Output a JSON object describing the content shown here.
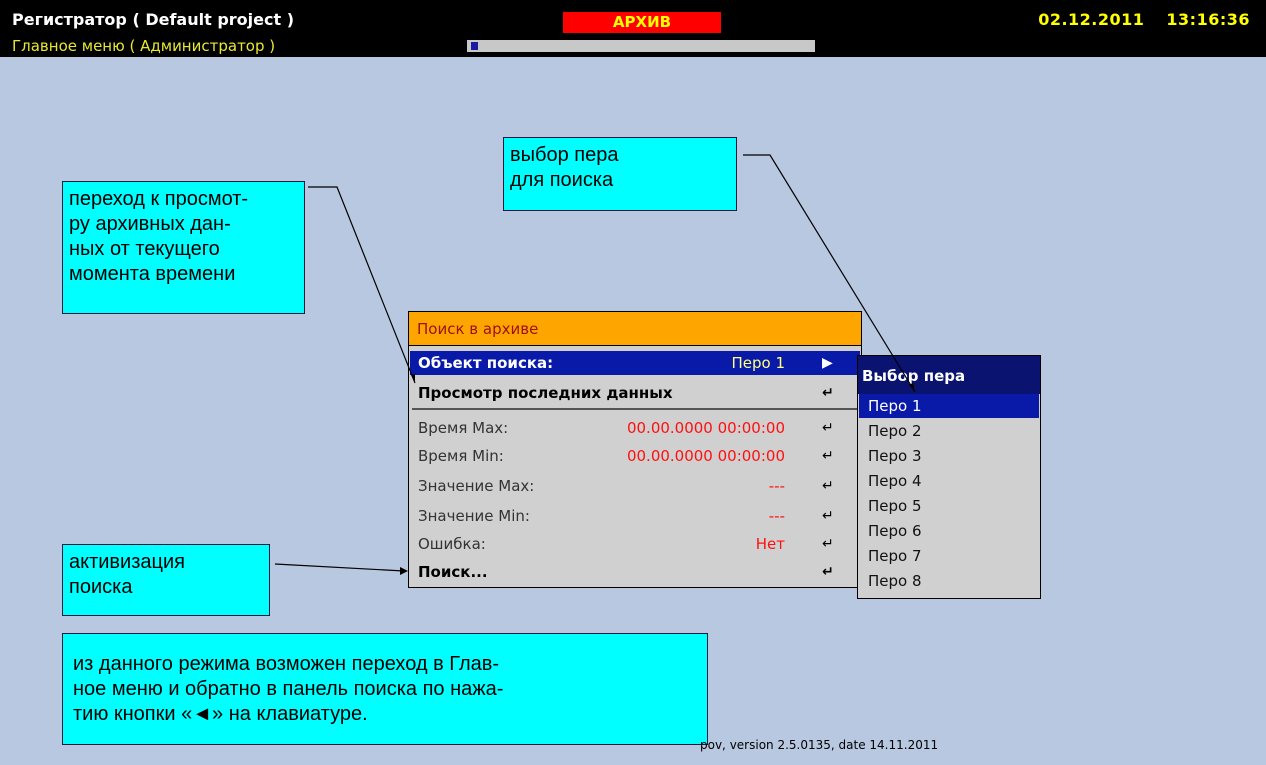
{
  "header": {
    "title": "Регистратор ( Default project )",
    "subtitle": "Главное меню ( Администратор )",
    "mode": "АРХИВ",
    "progress_fraction": 0.02,
    "date": "02.12.2011",
    "time": "13:16:36"
  },
  "dialog": {
    "title": "Поиск в архиве",
    "rows": [
      {
        "label": "Объект поиска:",
        "value": "Перо 1",
        "icon": "arrow-right-icon"
      },
      {
        "label": "Просмотр последних данных",
        "value": "",
        "icon": "enter-icon"
      },
      {
        "label": "Время Max:",
        "value": "00.00.0000 00:00:00",
        "icon": "enter-icon"
      },
      {
        "label": "Время Min:",
        "value": "00.00.0000 00:00:00",
        "icon": "enter-icon"
      },
      {
        "label": "Значение Max:",
        "value": "---",
        "icon": "enter-icon"
      },
      {
        "label": "Значение Min:",
        "value": "---",
        "icon": "enter-icon"
      },
      {
        "label": "Ошибка:",
        "value": "Нет",
        "icon": "enter-icon"
      },
      {
        "label": "Поиск...",
        "value": "",
        "icon": "enter-icon"
      }
    ]
  },
  "pen_list": {
    "title": "Выбор пера",
    "items": [
      "Перо 1",
      "Перо 2",
      "Перо 3",
      "Перо 4",
      "Перо 5",
      "Перо 6",
      "Перо 7",
      "Перо 8"
    ],
    "selected": "Перо 1"
  },
  "notes": {
    "pen_select": "выбор пера\nдля поиска",
    "view_latest": "переход к просмот-\nру архивных дан-\nных от текущего\nмомента времени",
    "activate_search": "активизация\nпоиска",
    "navigation": "из данного режима возможен переход в Глав-\nное меню и обратно в панель поиска по нажа-\nтию кнопки «◄» на клавиатуре."
  },
  "footer": {
    "version_text": "pov, version 2.5.0135, date 14.11.2011"
  },
  "colors": {
    "background": "#b8c8e0",
    "selection": "#0a1aa8",
    "dialog_header": "#ffa500",
    "note": "#00ffff",
    "mode_badge": "#ff0000"
  }
}
